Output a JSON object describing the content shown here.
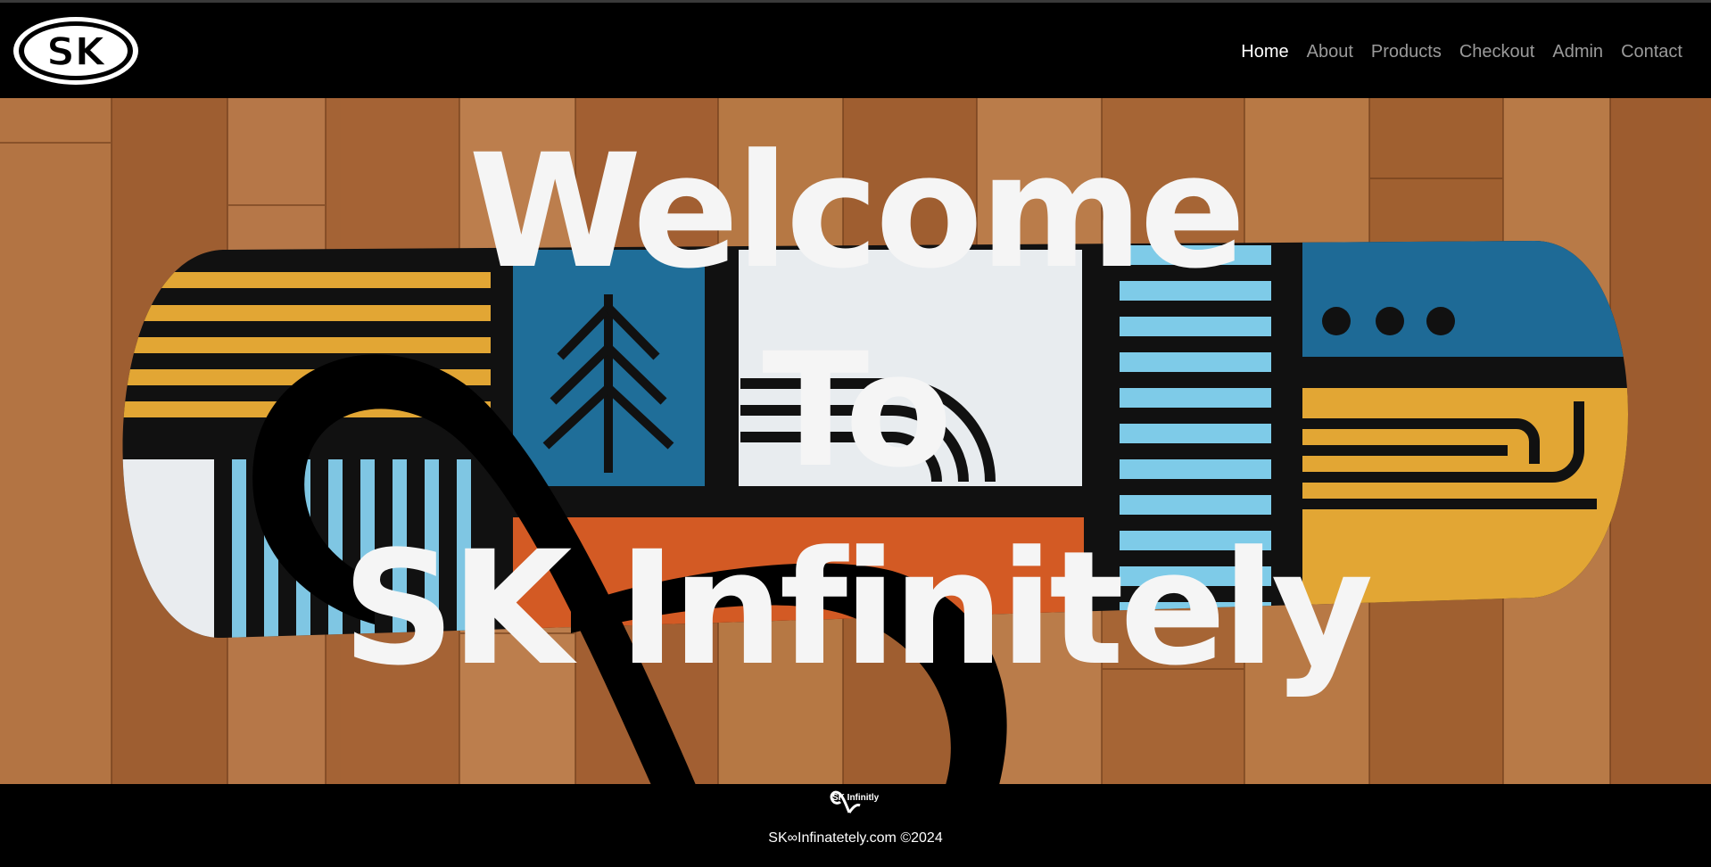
{
  "brand": {
    "logo_text": "SK",
    "logo_icon": "sk-circle-logo"
  },
  "nav": {
    "items": [
      {
        "label": "Home",
        "active": true
      },
      {
        "label": "About",
        "active": false
      },
      {
        "label": "Products",
        "active": false
      },
      {
        "label": "Checkout",
        "active": false
      },
      {
        "label": "Admin",
        "active": false
      },
      {
        "label": "Contact",
        "active": false
      }
    ]
  },
  "hero": {
    "line1": "Welcome",
    "line2": "To",
    "line3": "SK Infinitely",
    "background": "skateboard-on-wood-floor",
    "symbol": "infinity-icon"
  },
  "footer": {
    "logo_text": "SK Infinitly",
    "copyright": "SK∞Infinatetely.com ©2024"
  },
  "colors": {
    "nav_active": "#ffffff",
    "nav_inactive": "#9a9a9a",
    "background": "#000000",
    "hero_text": "#f5f5f5"
  }
}
